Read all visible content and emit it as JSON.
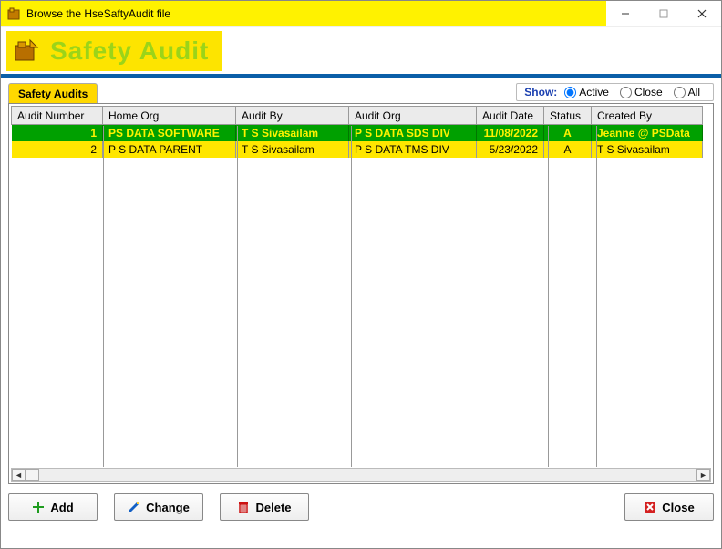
{
  "window": {
    "title": "Browse the HseSaftyAudit file"
  },
  "banner": {
    "title": "Safety Audit"
  },
  "tab": {
    "label": "Safety Audits"
  },
  "filter": {
    "label": "Show:",
    "options": {
      "active": "Active",
      "close": "Close",
      "all": "All"
    }
  },
  "columns": {
    "audit_number": "Audit Number",
    "home_org": "Home Org",
    "audit_by": "Audit By",
    "audit_org": "Audit Org",
    "audit_date": "Audit Date",
    "status": "Status",
    "created_by": "Created By"
  },
  "rows": [
    {
      "num": "1",
      "home_org": "PS DATA SOFTWARE",
      "audit_by": "T S Sivasailam",
      "audit_org": "P S  DATA SDS DIV",
      "audit_date": "11/08/2022",
      "status": "A",
      "created_by": "Jeanne @ PSData"
    },
    {
      "num": "2",
      "home_org": "P S DATA PARENT",
      "audit_by": "T S Sivasailam",
      "audit_org": "P S  DATA  TMS DIV",
      "audit_date": "5/23/2022",
      "status": "A",
      "created_by": "T S Sivasailam"
    }
  ],
  "buttons": {
    "add": "Add",
    "change": "Change",
    "delete": "Delete",
    "close": "Close"
  }
}
